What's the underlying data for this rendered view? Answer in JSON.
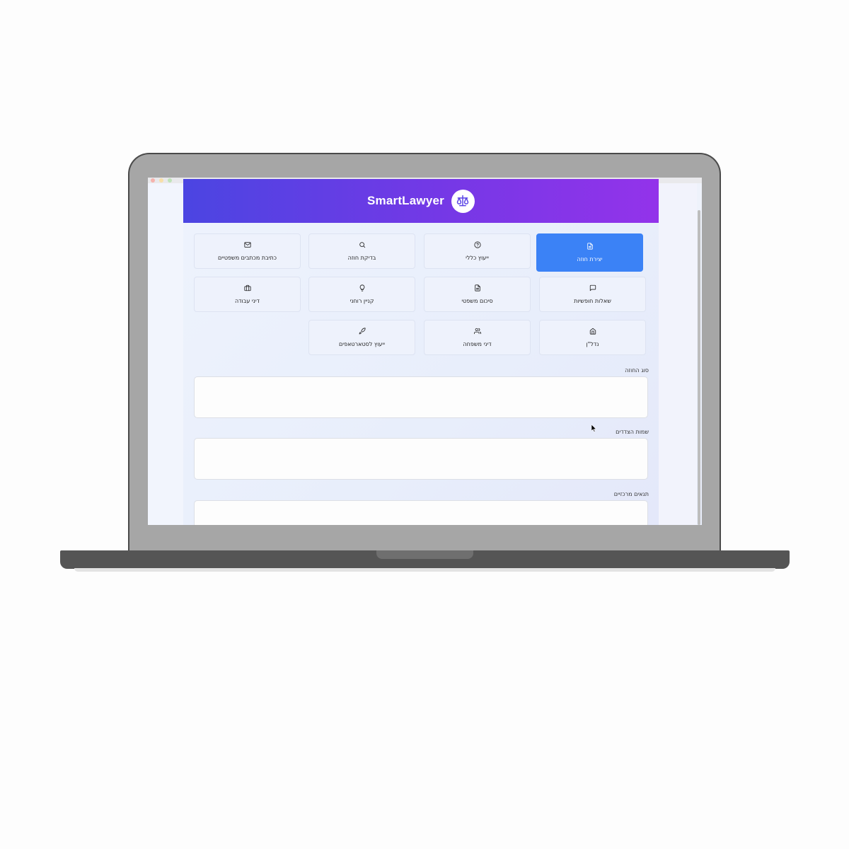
{
  "app": {
    "brand": "SmartLawyer",
    "window_title": ""
  },
  "logo": {
    "icon": "scales-icon",
    "accent": "#5b46e6"
  },
  "colors": {
    "header_start": "#4b45e2",
    "header_end": "#9333ea",
    "active_card": "#3b82f6"
  },
  "services": [
    {
      "label": "יצירת חוזה",
      "icon": "file-text-icon",
      "active": true
    },
    {
      "label": "ייעוץ כללי",
      "icon": "help-circle-icon",
      "active": false
    },
    {
      "label": "בדיקת חוזה",
      "icon": "search-icon",
      "active": false
    },
    {
      "label": "כתיבת מכתבים משפטיים",
      "icon": "mail-icon",
      "active": false
    },
    {
      "label": "שאלות חופשיות",
      "icon": "message-icon",
      "active": false
    },
    {
      "label": "סיכום משפטי",
      "icon": "document-icon",
      "active": false
    },
    {
      "label": "קניין רוחני",
      "icon": "lightbulb-icon",
      "active": false
    },
    {
      "label": "דיני עבודה",
      "icon": "briefcase-icon",
      "active": false
    },
    {
      "label": "נדל\"ן",
      "icon": "home-icon",
      "active": false
    },
    {
      "label": "דיני משפחה",
      "icon": "users-icon",
      "active": false
    },
    {
      "label": "ייעוץ לסטארטאפים",
      "icon": "rocket-icon",
      "active": false
    }
  ],
  "form": {
    "contract_type": {
      "label": "סוג החוזה",
      "value": ""
    },
    "party_names": {
      "label": "שמות הצדדים",
      "value": ""
    },
    "key_terms": {
      "label": "תנאים מרכזיים",
      "value": ""
    }
  }
}
